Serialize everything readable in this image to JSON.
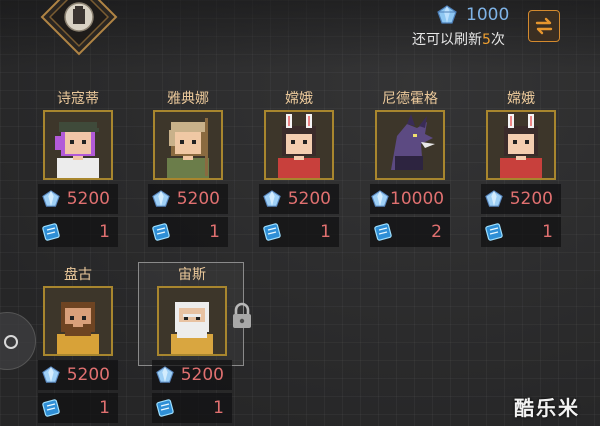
{
  "header": {
    "currency_icon": "diamond-gem-icon",
    "currency_amount": "1000",
    "refresh_prefix": "还可以刷新",
    "refresh_count": "5",
    "refresh_suffix": "次",
    "refresh_button_icon": "refresh-arrows-icon"
  },
  "characters": [
    {
      "name": "诗寇蒂",
      "gem_cost": "5200",
      "scroll_cost": "1"
    },
    {
      "name": "雅典娜",
      "gem_cost": "5200",
      "scroll_cost": "1"
    },
    {
      "name": "嫦娥",
      "gem_cost": "5200",
      "scroll_cost": "1"
    },
    {
      "name": "尼德霍格",
      "gem_cost": "10000",
      "scroll_cost": "2"
    },
    {
      "name": "嫦娥",
      "gem_cost": "5200",
      "scroll_cost": "1"
    },
    {
      "name": "盘古",
      "gem_cost": "5200",
      "scroll_cost": "1"
    },
    {
      "name": "宙斯",
      "gem_cost": "5200",
      "scroll_cost": "1",
      "locked": true,
      "selected": true
    }
  ],
  "watermark": "酷乐米",
  "colors": {
    "gold": "#a8862e",
    "cost_red": "#e07070",
    "currency_blue": "#7fb3e6",
    "refresh_orange": "#f0a030"
  }
}
